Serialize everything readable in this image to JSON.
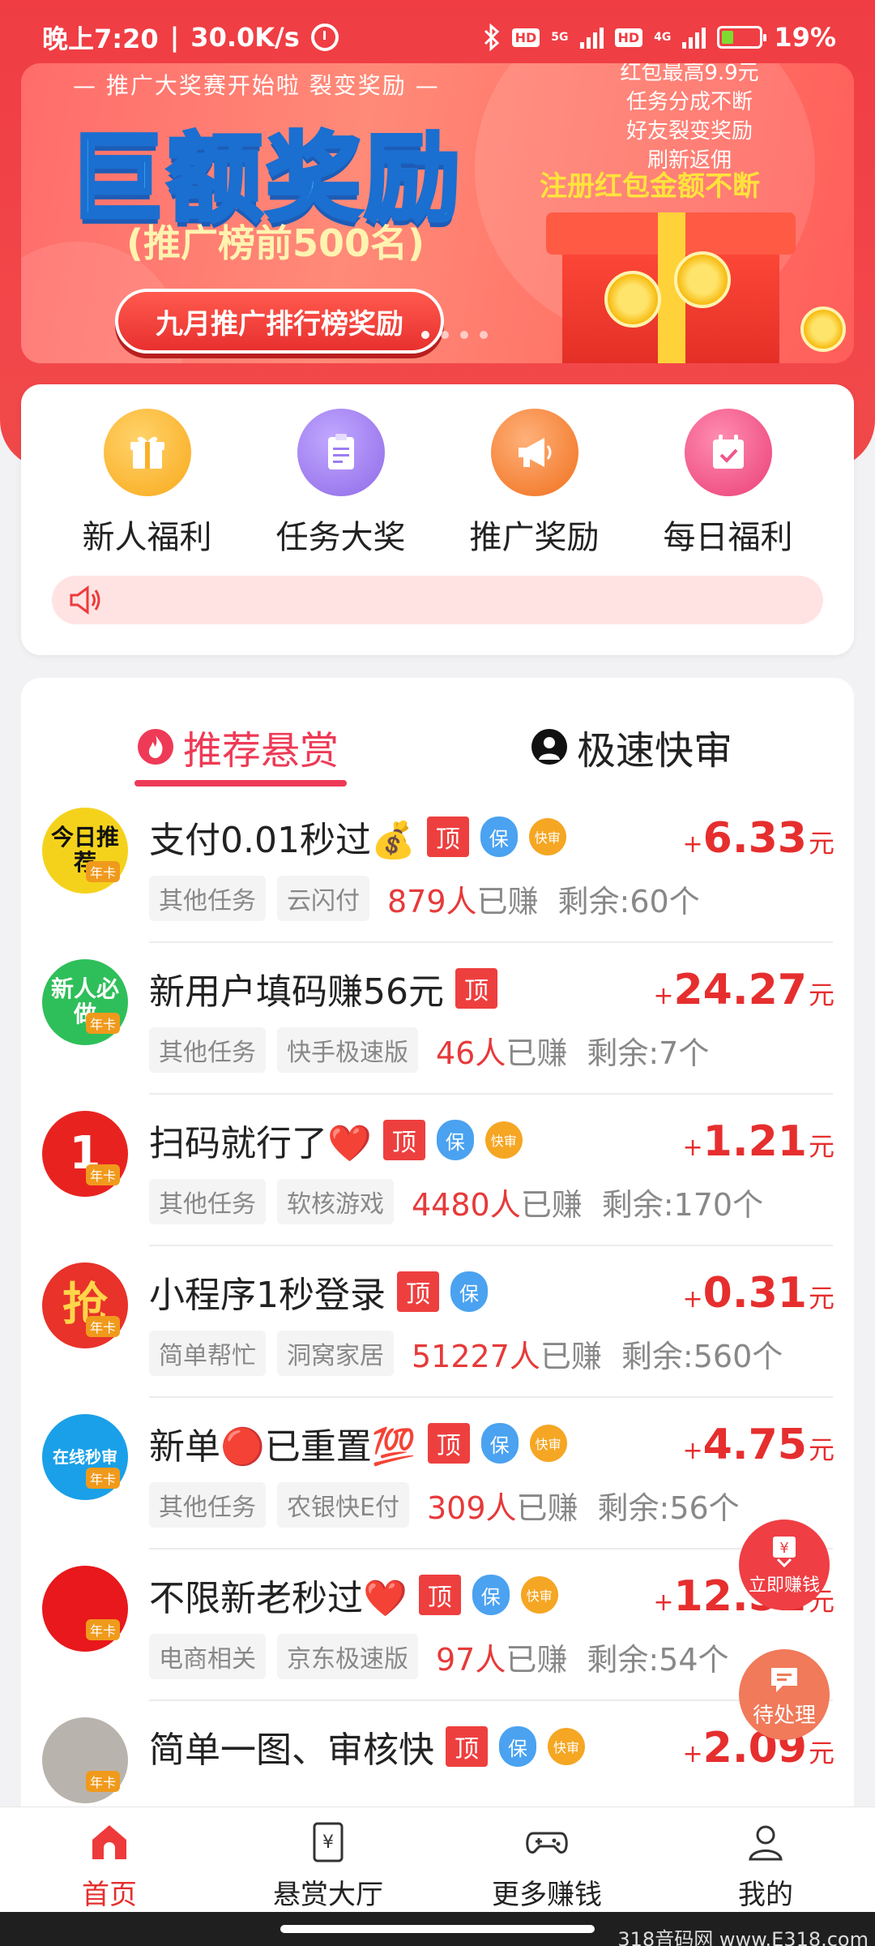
{
  "status_bar": {
    "time": "晚上7:20",
    "net_speed": "30.0K/s",
    "battery": "19%",
    "hd1": "HD",
    "hd2": "HD",
    "n5g": "5G",
    "n4g": "4G"
  },
  "banner": {
    "promo_line": "— 推广大奖赛开始啦  裂变奖励 —",
    "headline": "巨额奖励",
    "rank_text": "(推广榜前500名)",
    "button_label": "九月推广排行榜奖励",
    "right_lines": [
      "红包最高9.9元",
      "任务分成不断",
      "好友裂变奖励",
      "刷新返佣"
    ],
    "register_text": "注册红包金额不断",
    "page_count": 4,
    "active_page": 0
  },
  "quick_menu": {
    "items": [
      {
        "label": "新人福利",
        "icon": "gift-icon",
        "color": "#f9b12b"
      },
      {
        "label": "任务大奖",
        "icon": "clipboard-icon",
        "color": "#9d7cf2"
      },
      {
        "label": "推广奖励",
        "icon": "megaphone-icon",
        "color": "#f5843a"
      },
      {
        "label": "每日福利",
        "icon": "calendar-check-icon",
        "color": "#f0558a"
      }
    ],
    "notice_icon": "speaker-icon"
  },
  "tabs": {
    "recommended": "推荐悬赏",
    "fast_review": "极速快审",
    "active": "recommended"
  },
  "tasks": [
    {
      "avatar_text": "今日推荐",
      "avatar_color": "#f4d21c",
      "avatar_text_color": "#111",
      "badge": "年卡",
      "title": "支付0.01秒过💰",
      "tags": [
        "顶",
        "保",
        "快审"
      ],
      "category": "其他任务",
      "platform": "云闪付",
      "earned_count": "879人",
      "earned_suffix": "已赚",
      "remaining": "剩余:60个",
      "price_plus": "+",
      "price": "6.33",
      "unit": "元"
    },
    {
      "avatar_text": "新人必做",
      "avatar_color": "#2fbf5a",
      "avatar_text_color": "#fff",
      "badge": "年卡",
      "title": "新用户填码赚56元",
      "tags": [
        "顶"
      ],
      "category": "其他任务",
      "platform": "快手极速版",
      "earned_count": "46人",
      "earned_suffix": "已赚",
      "remaining": "剩余:7个",
      "price_plus": "+",
      "price": "24.27",
      "unit": "元"
    },
    {
      "avatar_text": "1",
      "avatar_color": "#e8231f",
      "avatar_text_color": "#fff",
      "badge": "年卡",
      "title": "扫码就行了❤️",
      "tags": [
        "顶",
        "保",
        "快审"
      ],
      "category": "其他任务",
      "platform": "软核游戏",
      "earned_count": "4480人",
      "earned_suffix": "已赚",
      "remaining": "剩余:170个",
      "price_plus": "+",
      "price": "1.21",
      "unit": "元"
    },
    {
      "avatar_text": "抢",
      "avatar_color": "#e8322a",
      "avatar_text_color": "#ffd54a",
      "badge": "年卡",
      "title": "小程序1秒登录",
      "tags": [
        "顶",
        "保"
      ],
      "category": "简单帮忙",
      "platform": "洞窝家居",
      "earned_count": "51227人",
      "earned_suffix": "已赚",
      "remaining": "剩余:560个",
      "price_plus": "+",
      "price": "0.31",
      "unit": "元"
    },
    {
      "avatar_text": "在线秒审",
      "avatar_color": "#1aa0e8",
      "avatar_text_color": "#fff",
      "badge": "年卡",
      "title": "新单🔴已重置💯",
      "tags": [
        "顶",
        "保",
        "快审"
      ],
      "category": "其他任务",
      "platform": "农银快E付",
      "earned_count": "309人",
      "earned_suffix": "已赚",
      "remaining": "剩余:56个",
      "price_plus": "+",
      "price": "4.75",
      "unit": "元"
    },
    {
      "avatar_text": "",
      "avatar_color": "#e8181c",
      "avatar_text_color": "#fff",
      "badge": "年卡",
      "title": "不限新老秒过❤️",
      "tags": [
        "顶",
        "保",
        "快审"
      ],
      "category": "电商相关",
      "platform": "京东极速版",
      "earned_count": "97人",
      "earned_suffix": "已赚",
      "remaining": "剩余:54个",
      "price_plus": "+",
      "price": "12.52",
      "unit": "元"
    },
    {
      "avatar_text": "",
      "avatar_color": "#b9b3ad",
      "avatar_text_color": "#fff",
      "badge": "年卡",
      "title": "简单一图、审核快",
      "tags": [
        "顶",
        "保",
        "快审"
      ],
      "category": "",
      "platform": "",
      "earned_count": "",
      "earned_suffix": "",
      "remaining": "",
      "price_plus": "+",
      "price": "2.09",
      "unit": "元"
    }
  ],
  "floating": {
    "earn_now": "立即赚钱",
    "pending": "待处理"
  },
  "bottom_nav": [
    {
      "label": "首页",
      "icon": "home-icon",
      "active": true
    },
    {
      "label": "悬赏大厅",
      "icon": "yuan-doc-icon",
      "active": false
    },
    {
      "label": "更多赚钱",
      "icon": "gamepad-icon",
      "active": false
    },
    {
      "label": "我的",
      "icon": "user-icon",
      "active": false
    }
  ],
  "watermark": "318音码网 www.E318.com"
}
